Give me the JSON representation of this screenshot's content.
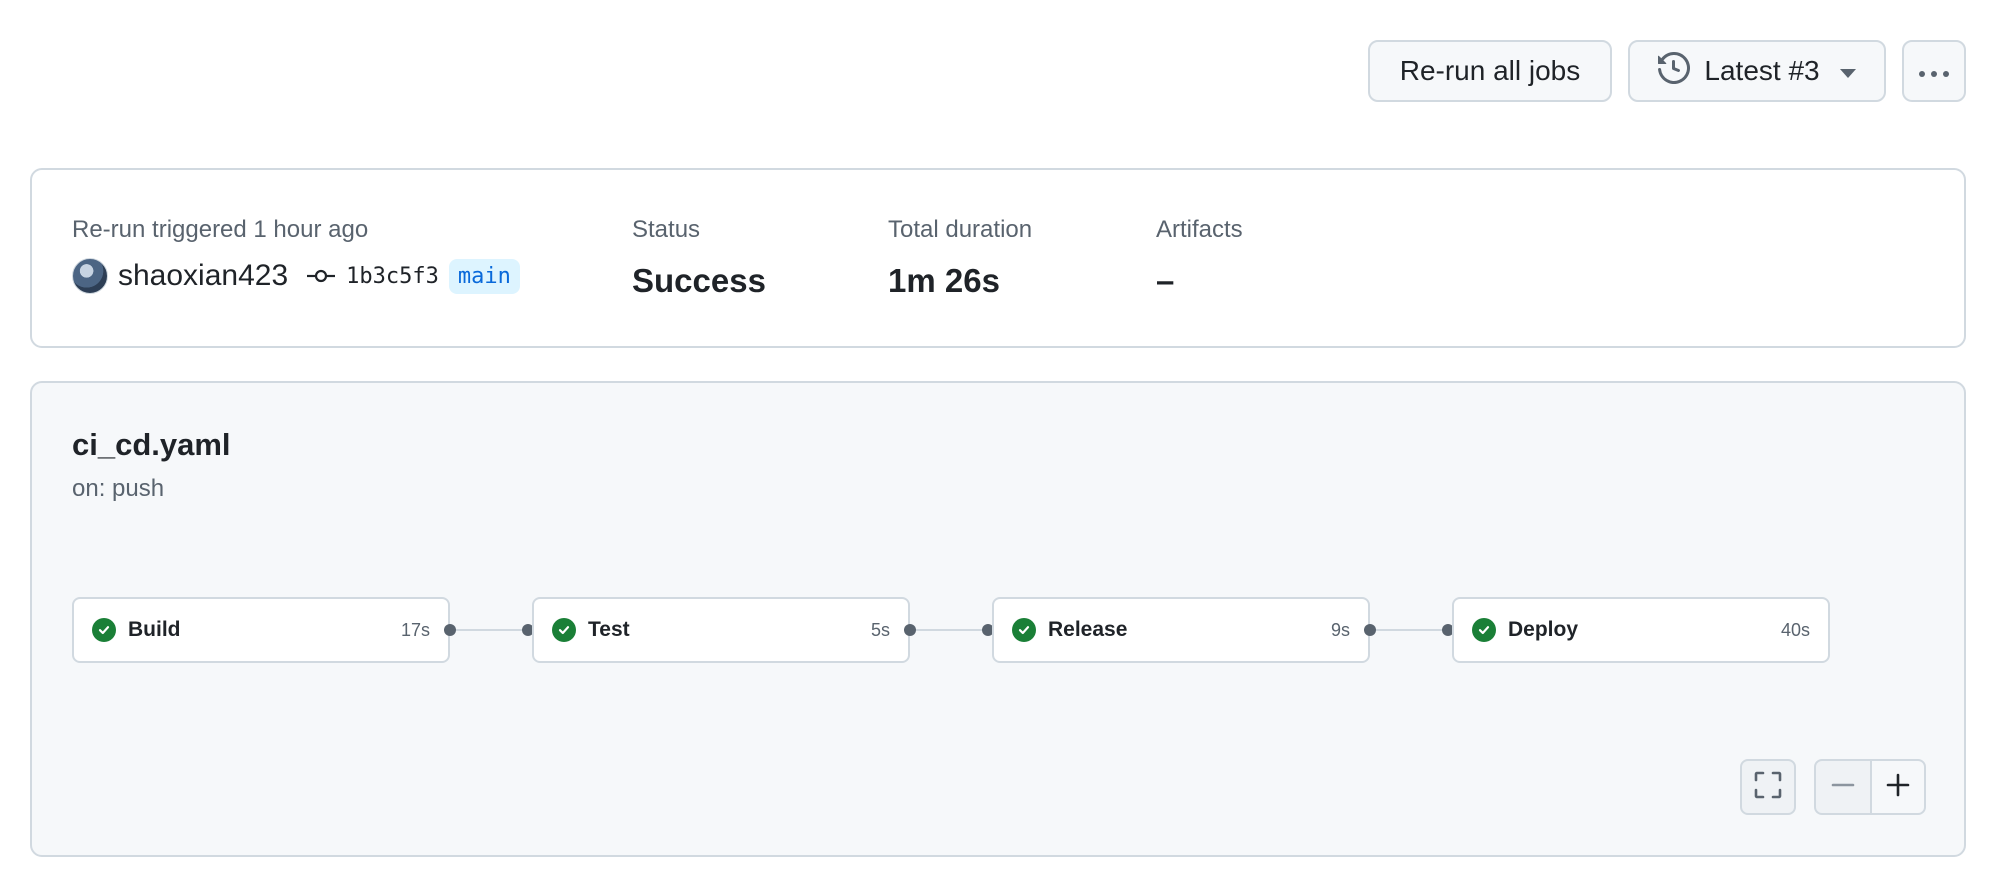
{
  "toolbar": {
    "rerun_label": "Re-run all jobs",
    "attempt_label": "Latest #3",
    "history_icon": "history-icon",
    "more_icon": "kebab-horizontal-icon"
  },
  "summary": {
    "trigger_text": "Re-run triggered 1 hour ago",
    "username": "shaoxian423",
    "commit_sha": "1b3c5f3",
    "branch": "main",
    "status_label": "Status",
    "status_value": "Success",
    "duration_label": "Total duration",
    "duration_value": "1m 26s",
    "artifacts_label": "Artifacts",
    "artifacts_value": "–"
  },
  "workflow": {
    "file": "ci_cd.yaml",
    "trigger": "on: push",
    "jobs": [
      {
        "name": "Build",
        "duration": "17s",
        "status": "success"
      },
      {
        "name": "Test",
        "duration": "5s",
        "status": "success"
      },
      {
        "name": "Release",
        "duration": "9s",
        "status": "success"
      },
      {
        "name": "Deploy",
        "duration": "40s",
        "status": "success"
      }
    ]
  },
  "colors": {
    "success": "#1a7f37",
    "link": "#0969da",
    "border": "#d1d9e0",
    "muted_text": "#59636e"
  }
}
